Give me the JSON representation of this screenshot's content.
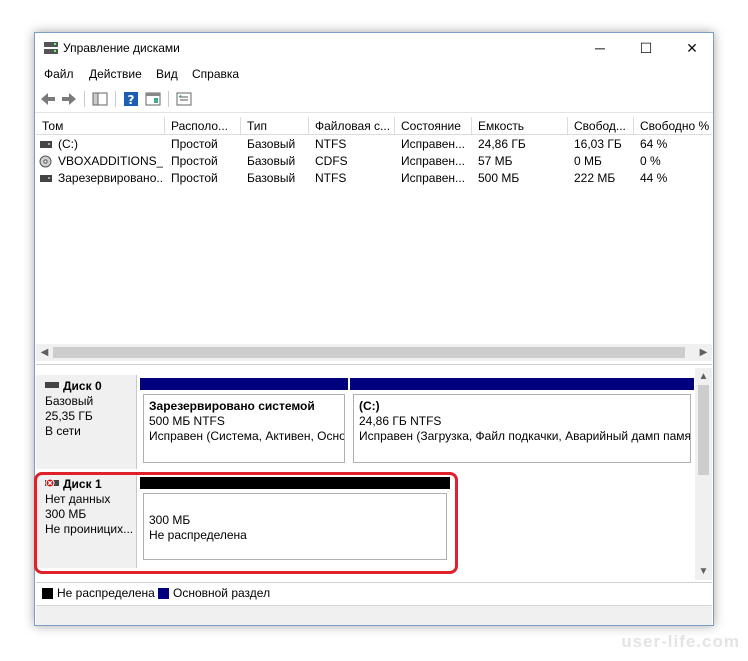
{
  "window": {
    "title": "Управление дисками",
    "minimize": "─",
    "maximize": "☐",
    "close": "✕"
  },
  "menu": [
    "Файл",
    "Действие",
    "Вид",
    "Справка"
  ],
  "toolbar": {
    "icons": [
      "back-arrow-icon",
      "forward-arrow-icon",
      "console-tree-icon",
      "help-icon",
      "properties-icon",
      "list-view-icon"
    ]
  },
  "volumes": {
    "columns": [
      "Том",
      "Располо...",
      "Тип",
      "Файловая с...",
      "Состояние",
      "Емкость",
      "Свобод...",
      "Свободно %"
    ],
    "rows": [
      {
        "icon": "volume-icon",
        "cells": [
          "(C:)",
          "Простой",
          "Базовый",
          "NTFS",
          "Исправен...",
          "24,86 ГБ",
          "16,03 ГБ",
          "64 %"
        ]
      },
      {
        "icon": "cd-drive-icon",
        "cells": [
          "VBOXADDITIONS_...",
          "Простой",
          "Базовый",
          "CDFS",
          "Исправен...",
          "57 МБ",
          "0 МБ",
          "0 %"
        ]
      },
      {
        "icon": "volume-icon",
        "cells": [
          "Зарезервировано...",
          "Простой",
          "Базовый",
          "NTFS",
          "Исправен...",
          "500 МБ",
          "222 МБ",
          "44 %"
        ]
      }
    ]
  },
  "disks": [
    {
      "name": "Диск 0",
      "lines": [
        "Базовый",
        "25,35 ГБ",
        "В сети"
      ],
      "partitions": [
        {
          "title": "Зарезервировано системой",
          "size": "500 МБ NTFS",
          "status": "Исправен (Система, Активен, Осно",
          "color": "#00007f"
        },
        {
          "title": "(C:)",
          "size": "24,86 ГБ NTFS",
          "status": "Исправен (Загрузка, Файл подкачки, Аварийный дамп памя",
          "color": "#00007f"
        }
      ]
    },
    {
      "name": "Диск 1",
      "lines": [
        "Нет данных",
        "300 МБ",
        "Не проиницих..."
      ],
      "partitions": [
        {
          "size": "300 МБ",
          "status": "Не распределена",
          "color": "#000000"
        }
      ]
    }
  ],
  "legend": [
    {
      "label": "Не распределена",
      "color": "#000000"
    },
    {
      "label": "Основной раздел",
      "color": "#00007f"
    }
  ],
  "watermark": "user-life.com"
}
